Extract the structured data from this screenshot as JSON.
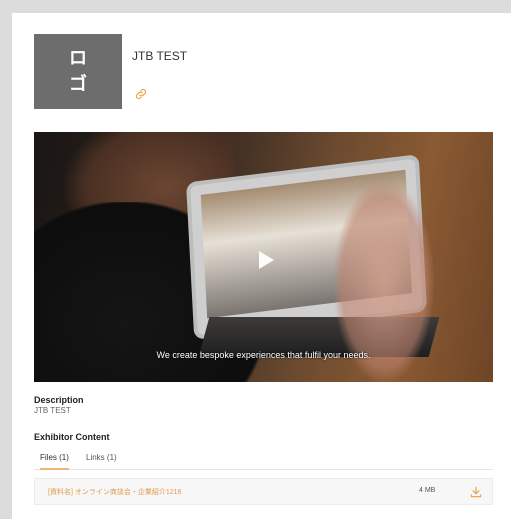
{
  "logo": {
    "line1": "ロ",
    "line2": "ゴ"
  },
  "company": {
    "name": "JTB TEST"
  },
  "video": {
    "caption": "We create bespoke experiences that fulfil your needs."
  },
  "description": {
    "label": "Description",
    "value": "JTB TEST"
  },
  "exhibitor": {
    "label": "Exhibitor Content",
    "tabs": [
      {
        "label": "Files (1)",
        "active": true
      },
      {
        "label": "Links (1)",
        "active": false
      }
    ],
    "files": [
      {
        "name": "[資料名] オンライン商談会・企業紹介1216",
        "size": "4 MB"
      }
    ]
  },
  "colors": {
    "accent": "#f0a040",
    "logo_bg": "#6d6d6d"
  },
  "icons": {
    "link": "link-icon",
    "play": "play-icon",
    "download": "download-icon"
  }
}
